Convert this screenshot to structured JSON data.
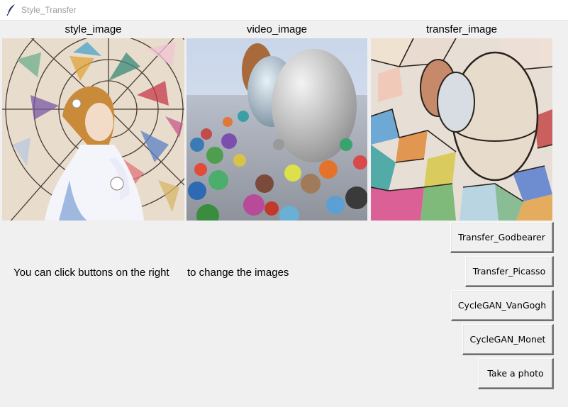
{
  "window": {
    "title": "Style_Transfer",
    "icon": "feather-icon"
  },
  "labels": {
    "style": "style_image",
    "video": "video_image",
    "transfer": "transfer_image"
  },
  "images": {
    "style": "stained-glass-woman-image",
    "video": "spheres-render-image",
    "transfer": "stylized-spheres-image"
  },
  "hint": {
    "part1": "You can click buttons on the right",
    "part2": "to change the images"
  },
  "buttons": {
    "godbearer": "Transfer_Godbearer",
    "picasso": "Transfer_Picasso",
    "vangogh": "CycleGAN_VanGogh",
    "monet": "CycleGAN_Monet",
    "photo": "Take a photo"
  }
}
